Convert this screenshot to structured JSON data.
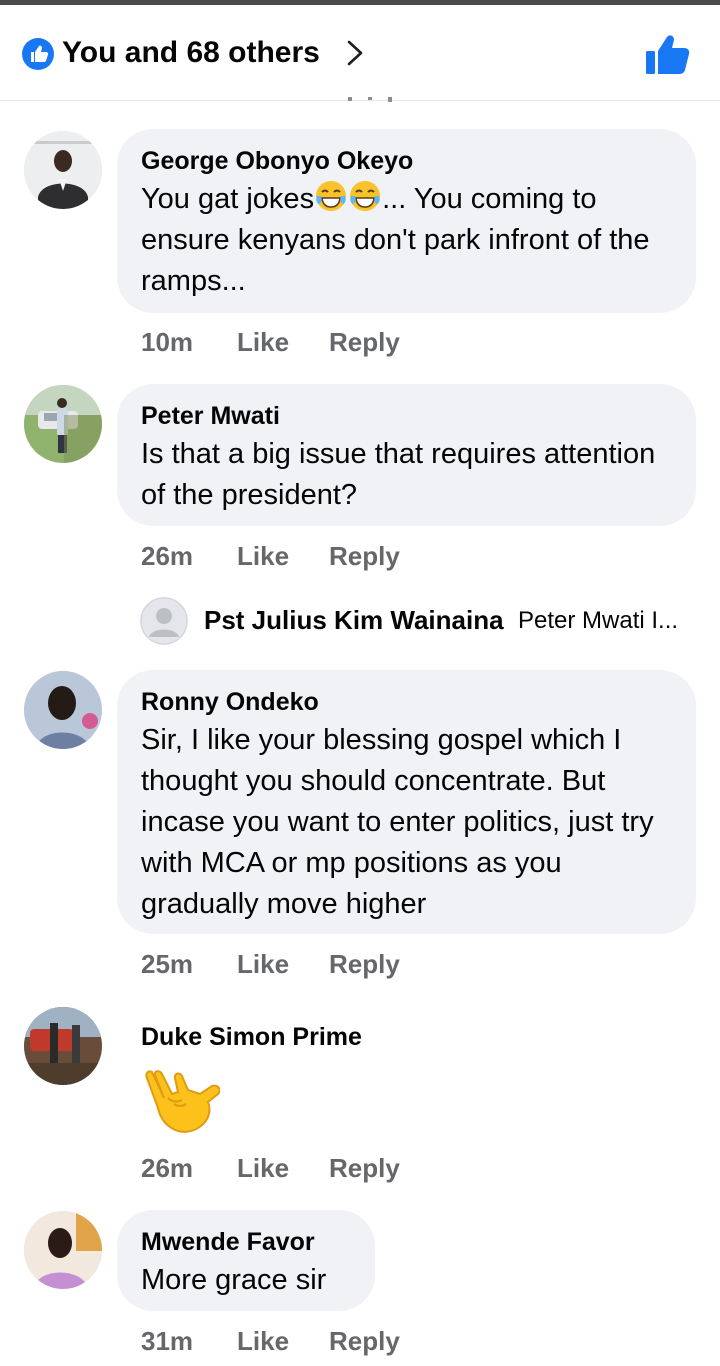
{
  "header": {
    "reactions_label": "You and 68 others",
    "icons": {
      "like_badge": "like-badge-icon",
      "chevron": "chevron-right-icon",
      "like": "thumbs-up-icon"
    },
    "accent": "#1877f2"
  },
  "comments": [
    {
      "author": "George Obonyo Okeyo",
      "text_before": "You gat jokes",
      "emoji": "face-with-tears-of-joy",
      "text_after": "... You coming to ensure kenyans don't park infront of the ramps...",
      "time": "10m",
      "like": "Like",
      "reply": "Reply"
    },
    {
      "author": "Peter Mwati",
      "text": "Is that a big issue that requires attention of the president?",
      "time": "26m",
      "like": "Like",
      "reply": "Reply",
      "reply_preview": {
        "author": "Pst Julius Kim Wainaina",
        "text": "Peter Mwati I..."
      }
    },
    {
      "author": "Ronny Ondeko",
      "text": "Sir, I like your blessing gospel which I thought you should concentrate. But incase you want to enter politics, just try with MCA or mp positions as you gradually move higher",
      "time": "25m",
      "like": "Like",
      "reply": "Reply"
    },
    {
      "author": "Duke Simon Prime",
      "emoji": "love-you-gesture",
      "time": "26m",
      "like": "Like",
      "reply": "Reply"
    },
    {
      "author": "Mwende Favor",
      "text": "More grace sir",
      "time": "31m",
      "like": "Like",
      "reply": "Reply"
    }
  ]
}
